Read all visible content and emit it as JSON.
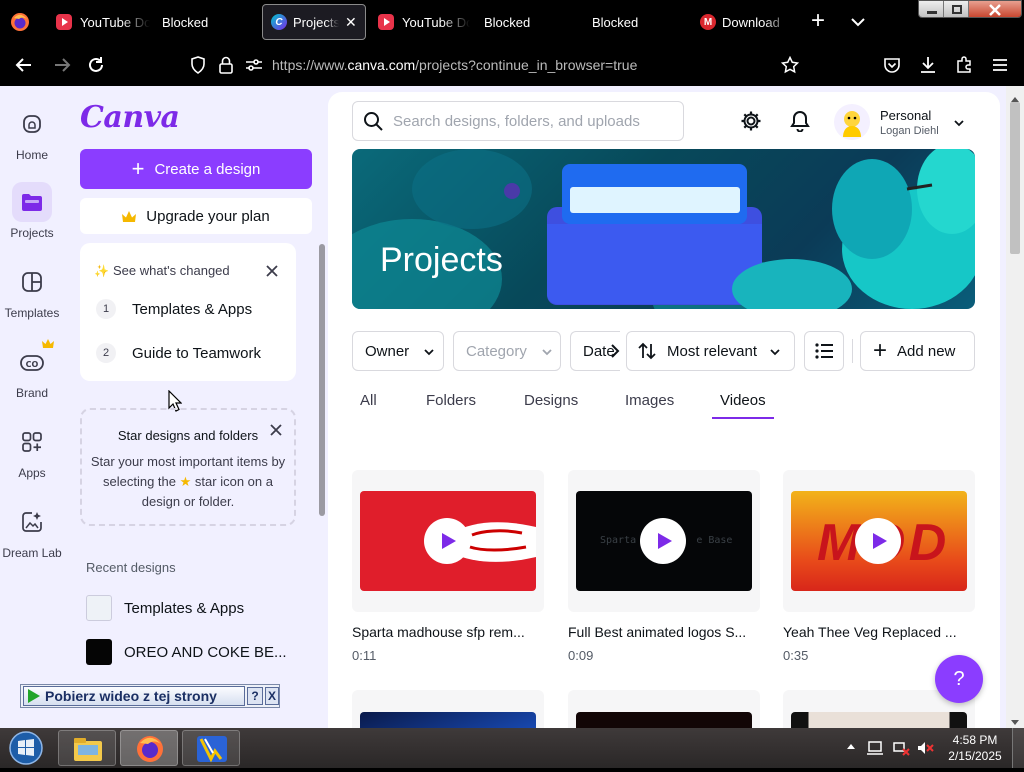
{
  "browser": {
    "tabs": [
      {
        "label": "YouTube Do",
        "icon": "youtube-downloader-icon"
      },
      {
        "label": "Blocked",
        "icon": ""
      },
      {
        "label": "Projects",
        "icon": "canva-icon"
      },
      {
        "label": "YouTube Do",
        "icon": "youtube-downloader-icon"
      },
      {
        "label": "Blocked",
        "icon": ""
      },
      {
        "label": "Blocked",
        "icon": ""
      },
      {
        "label": "Download",
        "icon": "mega-icon"
      }
    ],
    "close_glyph": "✕",
    "new_tab_glyph": "+",
    "url": {
      "prefix": "https://www.",
      "domain": "canva.com",
      "path": "/projects?continue_in_browser=true"
    }
  },
  "rail": {
    "items": [
      {
        "label": "Home",
        "icon": "home-icon"
      },
      {
        "label": "Projects",
        "icon": "folder-icon"
      },
      {
        "label": "Templates",
        "icon": "templates-icon"
      },
      {
        "label": "Brand",
        "icon": "brand-icon"
      },
      {
        "label": "Apps",
        "icon": "apps-icon"
      },
      {
        "label": "Dream Lab",
        "icon": "dream-lab-icon"
      }
    ]
  },
  "sidebar": {
    "logo": "Canva",
    "create_label": "Create a design",
    "upgrade_label": "Upgrade your plan",
    "whats_changed": {
      "title": "See what's changed",
      "items": [
        {
          "num": "1",
          "label": "Templates & Apps"
        },
        {
          "num": "2",
          "label": "Guide to Teamwork"
        }
      ]
    },
    "star_tip": {
      "title": "Star designs and folders",
      "body_1": "Star your most important items by selecting the",
      "body_2": "star icon on a design or folder."
    },
    "recent_title": "Recent designs",
    "recent": [
      {
        "label": "Templates & Apps"
      },
      {
        "label": "OREO AND COKE BE..."
      }
    ]
  },
  "topbar": {
    "search_placeholder": "Search designs, folders, and uploads",
    "account": {
      "label": "Personal",
      "name": "Logan Diehl"
    }
  },
  "hero": {
    "title": "Projects"
  },
  "filters": {
    "owner": "Owner",
    "category": "Category",
    "date": "Date",
    "sort": "Most relevant",
    "add_new": "Add new"
  },
  "tabs": [
    {
      "label": "All"
    },
    {
      "label": "Folders"
    },
    {
      "label": "Designs"
    },
    {
      "label": "Images"
    },
    {
      "label": "Videos",
      "active": true
    }
  ],
  "videos": [
    {
      "title": "Sparta madhouse sfp rem...",
      "duration": "0:11",
      "thumb_color": "#e01e2b"
    },
    {
      "title": "Full Best animated logos S...",
      "duration": "0:09",
      "thumb_color": "#050608"
    },
    {
      "title": "Yeah Thee Veg Replaced ...",
      "duration": "0:35",
      "thumb_color": "#e8a316"
    }
  ],
  "thumb_texts": {
    "second": "Sparta          e Base",
    "third": "MOD"
  },
  "help_label": "?",
  "extension_bar": {
    "label": "Pobierz wideo z tej strony",
    "help": "?",
    "close": "X"
  },
  "taskbar": {
    "time": "4:58 PM",
    "date": "2/15/2025"
  },
  "colors": {
    "accent": "#8b3dff",
    "tab_active": "#7d2ae8"
  }
}
